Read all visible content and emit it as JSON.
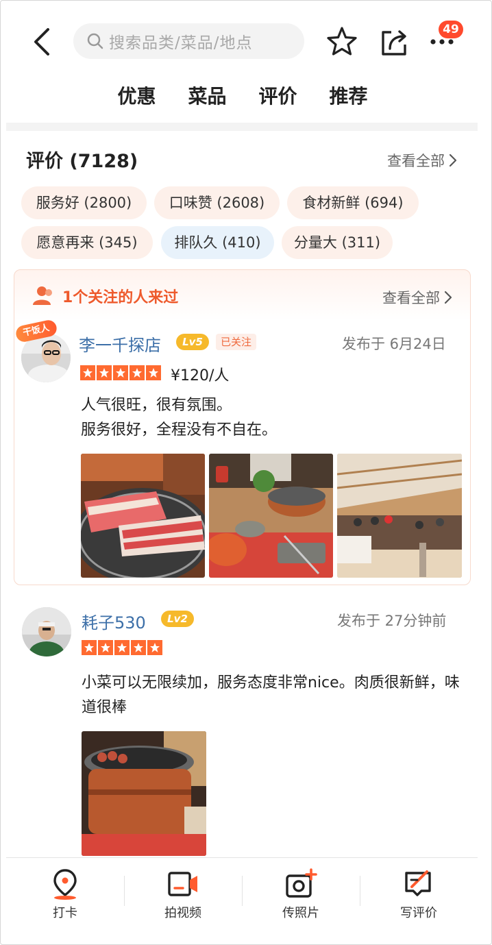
{
  "header": {
    "search_placeholder": "搜索品类/菜品/地点",
    "more_badge": "49",
    "icons": [
      "back-arrow-icon",
      "search-icon",
      "star-icon",
      "share-icon",
      "more-dots-icon"
    ]
  },
  "tabs": [
    {
      "label": "优惠",
      "active": false
    },
    {
      "label": "菜品",
      "active": true
    },
    {
      "label": "评价",
      "active": false
    },
    {
      "label": "推荐",
      "active": false
    }
  ],
  "reviews": {
    "title": "评价 (7128)",
    "view_all": "查看全部",
    "tags": [
      {
        "label": "服务好 (2800)"
      },
      {
        "label": "口味赞 (2608)"
      },
      {
        "label": "食材新鲜 (694)"
      },
      {
        "label": "愿意再来 (345)"
      },
      {
        "label": "排队久 (410)",
        "tone": "negative"
      },
      {
        "label": "分量大 (311)"
      }
    ]
  },
  "follow_card": {
    "heading": "1个关注的人来过",
    "view_all": "查看全部",
    "review": {
      "badge": "干饭人",
      "user": "李一千探店",
      "level": "Lv5",
      "followed_tag": "已关注",
      "published": "发布于 6月24日",
      "rating": 5,
      "price": "¥120/人",
      "lines": [
        "人气很旺，很有氛围。",
        "服务很好，全程没有不自在。"
      ],
      "photos": [
        "grilled-pork-belly-photo",
        "hotpot-table-photo",
        "restaurant-interior-photo"
      ]
    }
  },
  "review2": {
    "user": "耗子530",
    "level": "Lv2",
    "published": "发布于 27分钟前",
    "rating": 5,
    "text": "小菜可以无限续加，服务态度非常nice。肉质很新鲜，味道很棒",
    "photos": [
      "charcoal-grill-photo"
    ]
  },
  "bottom_bar": [
    {
      "label": "打卡",
      "icon": "location-pin-icon"
    },
    {
      "label": "拍视频",
      "icon": "video-camera-icon"
    },
    {
      "label": "传照片",
      "icon": "photo-upload-icon"
    },
    {
      "label": "写评价",
      "icon": "write-review-icon"
    }
  ],
  "colors": {
    "accent": "#ff5b2e",
    "link": "#3c6fa8",
    "level": "#f6b92b",
    "chip": "#fdf0ea",
    "chip_negative": "#e8f2fb"
  }
}
